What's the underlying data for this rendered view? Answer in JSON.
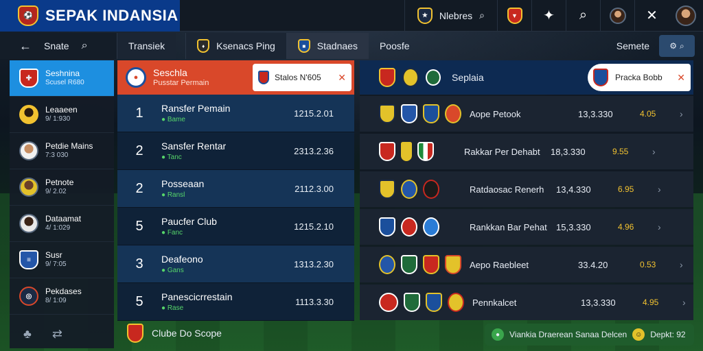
{
  "app": {
    "title": "SEPAK INDANSIA"
  },
  "topbar": {
    "search_label": "Nlebres",
    "icons": [
      "crest-icon",
      "cross-icon",
      "search-icon",
      "avatar-icon",
      "close-icon"
    ]
  },
  "subbar": {
    "back_label": "Snate",
    "tabs": [
      {
        "label": "Transiek"
      },
      {
        "label": "Ksenacs Ping"
      },
      {
        "label": "Stadnaes"
      },
      {
        "label": "Poosfe"
      }
    ],
    "right_label": "Semete"
  },
  "sidebar": {
    "items": [
      {
        "name": "Seshnina",
        "sub": "Scusel R680"
      },
      {
        "name": "Leaaeen",
        "sub": "9/ 1:930"
      },
      {
        "name": "Petdie Mains",
        "sub": "7:3 030"
      },
      {
        "name": "Petnote",
        "sub": "9/ 2.02"
      },
      {
        "name": "Dataamat",
        "sub": "4/ 1:029"
      },
      {
        "name": "Susr",
        "sub": "9/ 7:05"
      },
      {
        "name": "Pekdases",
        "sub": "8/ 1:09"
      }
    ]
  },
  "middle": {
    "header": {
      "title": "Seschla",
      "sub": "Pusstar Permain"
    },
    "popup": {
      "label": "Stalos N'605"
    },
    "rows": [
      {
        "rank": "1",
        "name": "Ransfer Pemain",
        "tag": "Bame",
        "value": "1215.2.01"
      },
      {
        "rank": "2",
        "name": "Sansfer Rentar",
        "tag": "Tanc",
        "value": "2313.2.36"
      },
      {
        "rank": "2",
        "name": "Posseaan",
        "tag": "Ransl",
        "value": "2112.3.00"
      },
      {
        "rank": "5",
        "name": "Paucfer Club",
        "tag": "Fanc",
        "value": "1215.2.10"
      },
      {
        "rank": "3",
        "name": "Deafeono",
        "tag": "Gans",
        "value": "1313.2.30"
      },
      {
        "rank": "5",
        "name": "Panescicrrestain",
        "tag": "Rase",
        "value": "1113.3.30"
      }
    ],
    "footer_label": "Clube Do Scope"
  },
  "right": {
    "header_title": "Seplaia",
    "popup_label": "Pracka Bobb",
    "matches": [
      {
        "name": "Aope Petook",
        "value": "13,3.330",
        "odds": "4.05"
      },
      {
        "name": "Rakkar Per Dehabt",
        "value": "18,3.330",
        "odds": "9.55"
      },
      {
        "name": "Ratdaosac Renerh",
        "value": "13,4.330",
        "odds": "6.95"
      },
      {
        "name": "Rankkan Bar Pehat",
        "value": "15,3.330",
        "odds": "4.96"
      },
      {
        "name": "Aepo Raebleet",
        "value": "33.4.20",
        "odds": "0.53"
      },
      {
        "name": "Pennkalcet",
        "value": "13,3.330",
        "odds": "4.95"
      }
    ]
  },
  "chip": {
    "label": "Viankia Draerean Sanaa Delcen",
    "score": "Depkt: 92"
  },
  "colors": {
    "brand": "#0a3a8a",
    "accent": "#1d8fe0",
    "highlight": "#d9482a",
    "odds": "#f2c230"
  }
}
